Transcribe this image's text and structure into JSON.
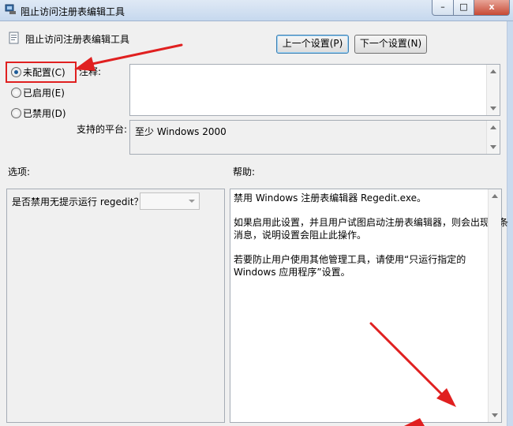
{
  "window": {
    "title": "阻止访问注册表编辑工具",
    "min_glyph": "–",
    "max_glyph": "□",
    "close_glyph": "x"
  },
  "header": {
    "title": "阻止访问注册表编辑工具",
    "prev_button": "上一个设置(P)",
    "next_button": "下一个设置(N)"
  },
  "radios": [
    {
      "label": "未配置(C)",
      "checked": true
    },
    {
      "label": "已启用(E)",
      "checked": false
    },
    {
      "label": "已禁用(D)",
      "checked": false
    }
  ],
  "comment": {
    "label": "注释:",
    "value": ""
  },
  "platform": {
    "label": "支持的平台:",
    "value": "至少 Windows 2000"
  },
  "options": {
    "label": "选项:",
    "question": "是否禁用无提示运行 regedit？",
    "combo_value": ""
  },
  "help": {
    "label": "帮助:",
    "paragraphs": [
      "禁用 Windows 注册表编辑器 Regedit.exe。",
      "如果启用此设置，并且用户试图启动注册表编辑器，则会出现一条",
      "消息，说明设置会阻止此操作。",
      "若要防止用户使用其他管理工具，请使用“只运行指定的",
      "Windows 应用程序”设置。"
    ]
  },
  "colors": {
    "annotation_red": "#e02020",
    "close_button": "#c74a35"
  },
  "icons": {
    "title": "policy-setting-icon",
    "header": "policy-document-icon"
  }
}
